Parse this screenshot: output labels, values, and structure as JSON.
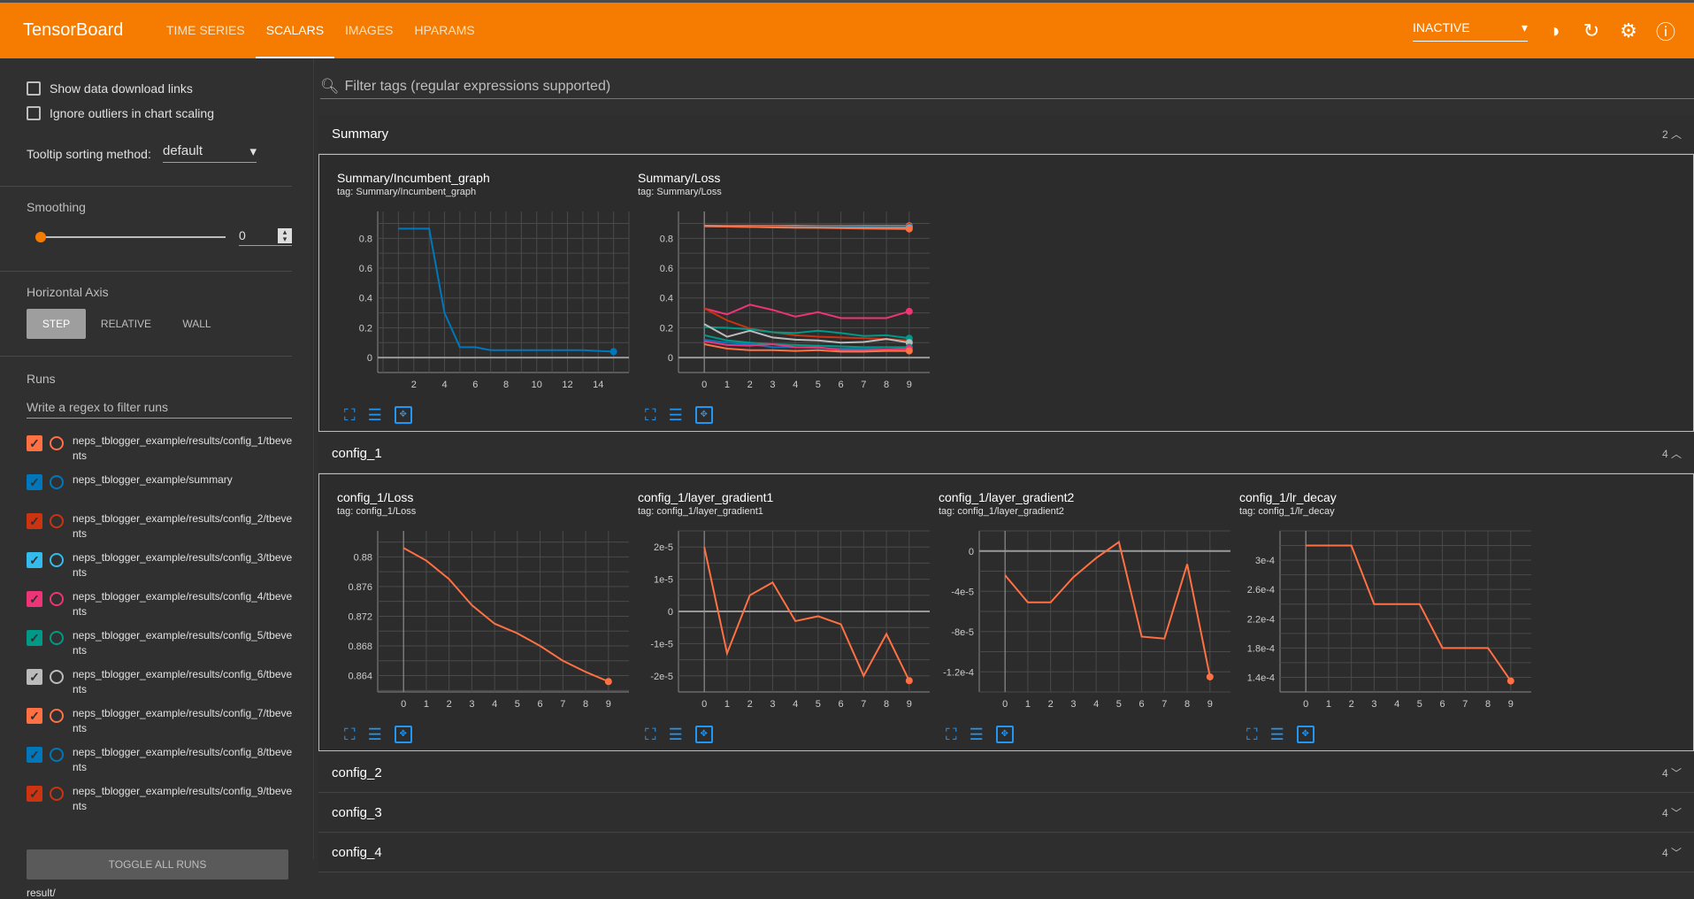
{
  "header": {
    "brand": "TensorBoard",
    "tabs": [
      "TIME SERIES",
      "SCALARS",
      "IMAGES",
      "HPARAMS"
    ],
    "active_tab": "SCALARS",
    "status": "INACTIVE",
    "icons": [
      "theme-icon",
      "refresh-icon",
      "settings-icon",
      "help-icon"
    ]
  },
  "sidebar": {
    "show_download": "Show data download links",
    "ignore_outliers": "Ignore outliers in chart scaling",
    "tooltip_label": "Tooltip sorting method:",
    "tooltip_value": "default",
    "smoothing_label": "Smoothing",
    "smoothing_value": "0",
    "haxis_label": "Horizontal Axis",
    "haxis_options": [
      "STEP",
      "RELATIVE",
      "WALL"
    ],
    "haxis_selected": "STEP",
    "runs_label": "Runs",
    "runs_filter_placeholder": "Write a regex to filter runs",
    "runs": [
      {
        "name": "neps_tblogger_example/results/config_1/tbevents",
        "color": "#ff7043"
      },
      {
        "name": "neps_tblogger_example/summary",
        "color": "#0077bb"
      },
      {
        "name": "neps_tblogger_example/results/config_2/tbevents",
        "color": "#cc3311"
      },
      {
        "name": "neps_tblogger_example/results/config_3/tbevents",
        "color": "#33bbee"
      },
      {
        "name": "neps_tblogger_example/results/config_4/tbevents",
        "color": "#ee3377"
      },
      {
        "name": "neps_tblogger_example/results/config_5/tbevents",
        "color": "#009988"
      },
      {
        "name": "neps_tblogger_example/results/config_6/tbevents",
        "color": "#bbbbbb"
      },
      {
        "name": "neps_tblogger_example/results/config_7/tbevents",
        "color": "#ff7043"
      },
      {
        "name": "neps_tblogger_example/results/config_8/tbevents",
        "color": "#0077bb"
      },
      {
        "name": "neps_tblogger_example/results/config_9/tbevents",
        "color": "#cc3311"
      }
    ],
    "toggle_all": "TOGGLE ALL RUNS",
    "result": "result/"
  },
  "main": {
    "filter_placeholder": "Filter tags (regular expressions supported)",
    "groups": [
      {
        "name": "Summary",
        "count": "2",
        "expanded": true
      },
      {
        "name": "config_1",
        "count": "4",
        "expanded": true
      },
      {
        "name": "config_2",
        "count": "4"
      },
      {
        "name": "config_3",
        "count": "4"
      },
      {
        "name": "config_4",
        "count": "4"
      }
    ]
  },
  "chart_data": [
    {
      "type": "line",
      "title": "Summary/Incumbent_graph",
      "subtitle": "tag: Summary/Incumbent_graph",
      "xlim": [
        0,
        16
      ],
      "ylim": [
        -0.1,
        0.98
      ],
      "xticks": [
        2,
        4,
        6,
        8,
        10,
        12,
        14
      ],
      "yticks": [
        0,
        0.2,
        0.4,
        0.6,
        0.8
      ],
      "yticklabels": [
        "0",
        "0.2",
        "0.4",
        "0.6",
        "0.8"
      ],
      "grid": true,
      "series": [
        {
          "color": "#0077bb",
          "x": [
            1,
            2,
            3,
            4,
            5,
            6,
            7,
            8,
            9,
            10,
            11,
            12,
            13,
            14,
            15
          ],
          "y": [
            0.865,
            0.865,
            0.865,
            0.3,
            0.07,
            0.07,
            0.05,
            0.05,
            0.05,
            0.05,
            0.05,
            0.05,
            0.05,
            0.045,
            0.04
          ]
        }
      ]
    },
    {
      "type": "line",
      "title": "Summary/Loss",
      "subtitle": "tag: Summary/Loss",
      "xlim": [
        -0.9,
        9.9
      ],
      "ylim": [
        -0.1,
        0.98
      ],
      "xticks": [
        0,
        1,
        2,
        3,
        4,
        5,
        6,
        7,
        8,
        9
      ],
      "yticks": [
        0,
        0.2,
        0.4,
        0.6,
        0.8
      ],
      "yticklabels": [
        "0",
        "0.2",
        "0.4",
        "0.6",
        "0.8"
      ],
      "grid": true,
      "series": [
        {
          "color": "#bbbbbb",
          "x": [
            0,
            1,
            2,
            3,
            4,
            5,
            6,
            7,
            8,
            9
          ],
          "y": [
            0.885,
            0.884,
            0.884,
            0.884,
            0.884,
            0.883,
            0.883,
            0.883,
            0.883,
            0.883
          ]
        },
        {
          "color": "#cc3311",
          "x": [
            0,
            1,
            2,
            3,
            4,
            5,
            6,
            7,
            8,
            9
          ],
          "y": [
            0.883,
            0.882,
            0.881,
            0.881,
            0.88,
            0.88,
            0.88,
            0.879,
            0.879,
            0.879
          ]
        },
        {
          "color": "#33bbee",
          "x": [
            0,
            1,
            2,
            3,
            4,
            5,
            6,
            7,
            8,
            9
          ],
          "y": [
            0.881,
            0.879,
            0.877,
            0.875,
            0.874,
            0.873,
            0.872,
            0.872,
            0.871,
            0.871
          ]
        },
        {
          "color": "#ff7043",
          "x": [
            0,
            1,
            2,
            3,
            4,
            5,
            6,
            7,
            8,
            9
          ],
          "y": [
            0.881,
            0.879,
            0.877,
            0.874,
            0.871,
            0.87,
            0.868,
            0.866,
            0.864,
            0.863
          ]
        },
        {
          "color": "#ee3377",
          "x": [
            0,
            1,
            2,
            3,
            4,
            5,
            6,
            7,
            8,
            9
          ],
          "y": [
            0.33,
            0.29,
            0.355,
            0.32,
            0.275,
            0.305,
            0.265,
            0.265,
            0.265,
            0.31
          ]
        },
        {
          "color": "#cc3311",
          "x": [
            0,
            1,
            2,
            3,
            4,
            5,
            6,
            7,
            8,
            9
          ],
          "y": [
            0.33,
            0.25,
            0.195,
            0.17,
            0.15,
            0.14,
            0.135,
            0.13,
            0.125,
            0.115
          ]
        },
        {
          "color": "#009988",
          "x": [
            0,
            1,
            2,
            3,
            4,
            5,
            6,
            7,
            8,
            9
          ],
          "y": [
            0.205,
            0.2,
            0.19,
            0.17,
            0.165,
            0.18,
            0.165,
            0.145,
            0.15,
            0.13
          ]
        },
        {
          "color": "#bbbbbb",
          "x": [
            0,
            1,
            2,
            3,
            4,
            5,
            6,
            7,
            8,
            9
          ],
          "y": [
            0.225,
            0.14,
            0.18,
            0.135,
            0.12,
            0.115,
            0.1,
            0.105,
            0.125,
            0.1
          ]
        },
        {
          "color": "#009988",
          "x": [
            0,
            1,
            2,
            3,
            4,
            5,
            6,
            7,
            8,
            9
          ],
          "y": [
            0.15,
            0.115,
            0.1,
            0.09,
            0.085,
            0.08,
            0.075,
            0.07,
            0.07,
            0.07
          ]
        },
        {
          "color": "#0077bb",
          "x": [
            0,
            1,
            2,
            3,
            4,
            5,
            6,
            7,
            8,
            9
          ],
          "y": [
            0.12,
            0.1,
            0.09,
            0.07,
            0.07,
            0.065,
            0.06,
            0.06,
            0.055,
            0.05
          ]
        },
        {
          "color": "#ee3377",
          "x": [
            0,
            1,
            2,
            3,
            4,
            5,
            6,
            7,
            8,
            9
          ],
          "y": [
            0.11,
            0.085,
            0.08,
            0.09,
            0.07,
            0.07,
            0.05,
            0.05,
            0.055,
            0.06
          ]
        },
        {
          "color": "#ff7043",
          "x": [
            0,
            1,
            2,
            3,
            4,
            5,
            6,
            7,
            8,
            9
          ],
          "y": [
            0.09,
            0.06,
            0.05,
            0.05,
            0.045,
            0.05,
            0.04,
            0.04,
            0.045,
            0.045
          ]
        }
      ]
    },
    {
      "type": "line",
      "title": "config_1/Loss",
      "subtitle": "tag: config_1/Loss",
      "xlim": [
        -0.9,
        9.9
      ],
      "ylim": [
        0.8618,
        0.8835
      ],
      "xticks": [
        0,
        1,
        2,
        3,
        4,
        5,
        6,
        7,
        8,
        9
      ],
      "yticks": [
        0.864,
        0.868,
        0.872,
        0.876,
        0.88
      ],
      "yticklabels": [
        "0.864",
        "0.868",
        "0.872",
        "0.876",
        "0.88"
      ],
      "grid": true,
      "series": [
        {
          "color": "#ff7043",
          "x": [
            0,
            1,
            2,
            3,
            4,
            5,
            6,
            7,
            8,
            9
          ],
          "y": [
            0.8812,
            0.8795,
            0.877,
            0.8735,
            0.871,
            0.8697,
            0.868,
            0.866,
            0.8645,
            0.8632
          ]
        }
      ]
    },
    {
      "type": "line",
      "title": "config_1/layer_gradient1",
      "subtitle": "tag: config_1/layer_gradient1",
      "xlim": [
        -0.9,
        9.9
      ],
      "ylim": [
        -2.5e-05,
        2.5e-05
      ],
      "xticks": [
        0,
        1,
        2,
        3,
        4,
        5,
        6,
        7,
        8,
        9
      ],
      "yticks": [
        -2e-05,
        -1e-05,
        0,
        1e-05,
        2e-05
      ],
      "yticklabels": [
        "-2e-5",
        "-1e-5",
        "0",
        "1e-5",
        "2e-5"
      ],
      "grid": true,
      "series": [
        {
          "color": "#ff7043",
          "x": [
            0,
            1,
            2,
            3,
            4,
            5,
            6,
            7,
            8,
            9
          ],
          "y": [
            2e-05,
            -1.3e-05,
            5e-06,
            9e-06,
            -3e-06,
            -1.5e-06,
            -4e-06,
            -2e-05,
            -7e-06,
            -2.15e-05
          ]
        }
      ]
    },
    {
      "type": "line",
      "title": "config_1/layer_gradient2",
      "subtitle": "tag: config_1/layer_gradient2",
      "xlim": [
        -0.9,
        9.9
      ],
      "ylim": [
        -0.00014,
        2e-05
      ],
      "xticks": [
        0,
        1,
        2,
        3,
        4,
        5,
        6,
        7,
        8,
        9
      ],
      "yticks": [
        -0.00012,
        -8e-05,
        -4e-05,
        0
      ],
      "yticklabels": [
        "-1.2e-4",
        "-8e-5",
        "-4e-5",
        "0"
      ],
      "grid": true,
      "series": [
        {
          "color": "#ff7043",
          "x": [
            0,
            1,
            2,
            3,
            4,
            5,
            6,
            7,
            8,
            9
          ],
          "y": [
            -2.4e-05,
            -5.1e-05,
            -5.1e-05,
            -2.6e-05,
            -7e-06,
            9e-06,
            -8.5e-05,
            -8.7e-05,
            -1.3e-05,
            -0.000125
          ]
        }
      ]
    },
    {
      "type": "line",
      "title": "config_1/lr_decay",
      "subtitle": "tag: config_1/lr_decay",
      "xlim": [
        -0.9,
        9.9
      ],
      "ylim": [
        0.00012,
        0.00034
      ],
      "xticks": [
        0,
        1,
        2,
        3,
        4,
        5,
        6,
        7,
        8,
        9
      ],
      "yticks": [
        0.00014,
        0.00018,
        0.00022,
        0.00026,
        0.0003
      ],
      "yticklabels": [
        "1.4e-4",
        "1.8e-4",
        "2.2e-4",
        "2.6e-4",
        "3e-4"
      ],
      "grid": true,
      "series": [
        {
          "color": "#ff7043",
          "x": [
            0,
            1,
            2,
            3,
            4,
            5,
            6,
            7,
            8,
            9
          ],
          "y": [
            0.00032,
            0.00032,
            0.00032,
            0.00024,
            0.00024,
            0.00024,
            0.00018,
            0.00018,
            0.00018,
            0.000135
          ]
        }
      ]
    }
  ]
}
